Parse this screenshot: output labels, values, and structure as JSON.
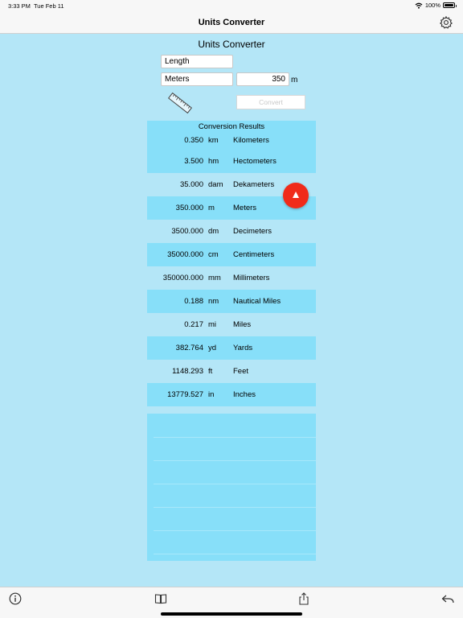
{
  "status": {
    "time": "3:33 PM",
    "date": "Tue Feb 11",
    "battery": "100%"
  },
  "nav": {
    "title": "Units Converter",
    "settings_icon": "gear-icon"
  },
  "form": {
    "title": "Units Converter",
    "category": "Length",
    "from_unit": "Meters",
    "value": "350",
    "unit_suffix": "m",
    "convert_label": "Convert",
    "icon": "ruler-icon"
  },
  "results": {
    "header": "Conversion Results",
    "rows": [
      {
        "value": "0.350",
        "abbr": "km",
        "name": "Kilometers"
      },
      {
        "value": "3.500",
        "abbr": "hm",
        "name": "Hectometers"
      },
      {
        "value": "35.000",
        "abbr": "dam",
        "name": "Dekameters"
      },
      {
        "value": "350.000",
        "abbr": "m",
        "name": "Meters"
      },
      {
        "value": "3500.000",
        "abbr": "dm",
        "name": "Decimeters"
      },
      {
        "value": "35000.000",
        "abbr": "cm",
        "name": "Centimeters"
      },
      {
        "value": "350000.000",
        "abbr": "mm",
        "name": "Millimeters"
      },
      {
        "value": "0.188",
        "abbr": "nm",
        "name": "Nautical Miles"
      },
      {
        "value": "0.217",
        "abbr": "mi",
        "name": "Miles"
      },
      {
        "value": "382.764",
        "abbr": "yd",
        "name": "Yards"
      },
      {
        "value": "1148.293",
        "abbr": "ft",
        "name": "Feet"
      },
      {
        "value": "13779.527",
        "abbr": "in",
        "name": "Inches"
      }
    ]
  },
  "toolbar": {
    "items": [
      "info-icon",
      "book-icon",
      "share-icon",
      "undo-icon"
    ]
  },
  "colors": {
    "background": "#b4e6f7",
    "row_alt": "#87dff9",
    "fab": "#f02b1a"
  }
}
